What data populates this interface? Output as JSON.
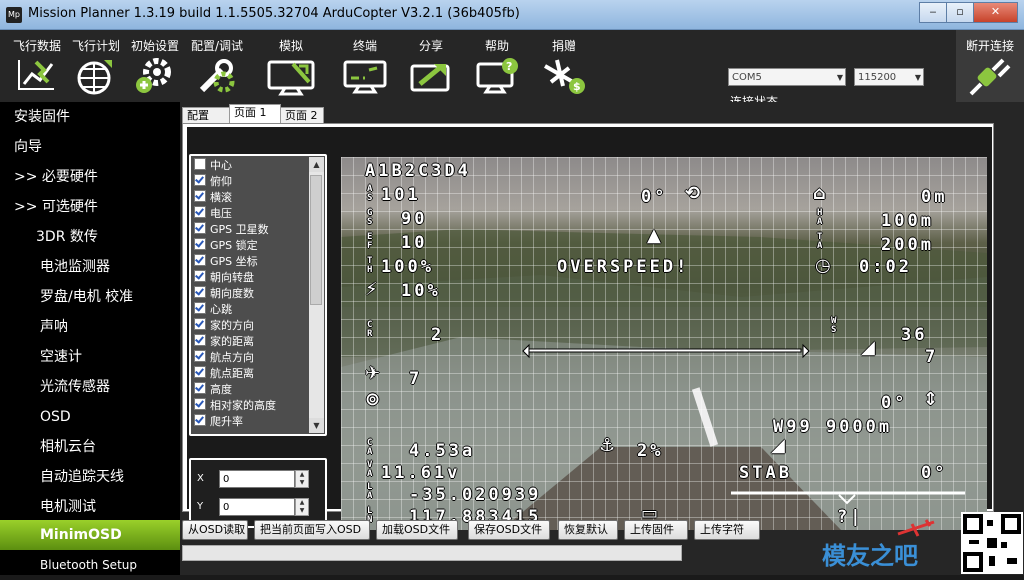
{
  "window": {
    "title": "Mission Planner 1.3.19 build 1.1.5505.32704 ArduCopter V3.2.1 (36b405fb)",
    "icon_label": "Mp",
    "controls": [
      "minimize-icon",
      "restore-icon",
      "close-icon"
    ]
  },
  "menu": {
    "items": [
      {
        "label": "飞行数据",
        "icon": "flight-data-icon"
      },
      {
        "label": "飞行计划",
        "icon": "flight-plan-icon"
      },
      {
        "label": "初始设置",
        "icon": "initial-setup-icon"
      },
      {
        "label": "配置/调试",
        "icon": "config-tuning-icon"
      },
      {
        "label": "模拟",
        "icon": "simulation-icon"
      },
      {
        "label": "终端",
        "icon": "terminal-icon"
      },
      {
        "label": "分享",
        "icon": "share-icon"
      },
      {
        "label": "帮助",
        "icon": "help-icon"
      },
      {
        "label": "捐赠",
        "icon": "donate-icon"
      }
    ],
    "com_port": "COM5",
    "baud_rate": "115200",
    "link_status": "连接状态...",
    "connect_label": "断开连接"
  },
  "sidebar": {
    "items": [
      {
        "label": "安装固件",
        "indent": 0
      },
      {
        "label": "向导",
        "indent": 0
      },
      {
        "label": ">> 必要硬件",
        "indent": 0
      },
      {
        "label": ">> 可选硬件",
        "indent": 0
      },
      {
        "label": "3DR 数传",
        "indent": 1
      },
      {
        "label": "电池监测器",
        "indent": 1
      },
      {
        "label": "罗盘/电机 校准",
        "indent": 1
      },
      {
        "label": "声呐",
        "indent": 1
      },
      {
        "label": "空速计",
        "indent": 1
      },
      {
        "label": "光流传感器",
        "indent": 1
      },
      {
        "label": "OSD",
        "indent": 1
      },
      {
        "label": "相机云台",
        "indent": 1
      },
      {
        "label": "自动追踪天线",
        "indent": 1
      },
      {
        "label": "电机测试",
        "indent": 1
      },
      {
        "label": "MinimOSD",
        "indent": 1,
        "active": true
      },
      {
        "label": "Bluetooth Setup",
        "indent": 1
      }
    ]
  },
  "tabs": [
    {
      "label": "配置",
      "active": false
    },
    {
      "label": "页面 1",
      "active": true
    },
    {
      "label": "页面 2",
      "active": false
    }
  ],
  "osd_items": [
    {
      "label": "中心",
      "checked": false
    },
    {
      "label": "俯仰",
      "checked": true
    },
    {
      "label": "横滚",
      "checked": true
    },
    {
      "label": "电压",
      "checked": true
    },
    {
      "label": "GPS 卫星数",
      "checked": true
    },
    {
      "label": "GPS 锁定",
      "checked": true
    },
    {
      "label": "GPS 坐标",
      "checked": true
    },
    {
      "label": "朝向转盘",
      "checked": true
    },
    {
      "label": "朝向度数",
      "checked": true
    },
    {
      "label": "心跳",
      "checked": true
    },
    {
      "label": "家的方向",
      "checked": true
    },
    {
      "label": "家的距离",
      "checked": true
    },
    {
      "label": "航点方向",
      "checked": true
    },
    {
      "label": "航点距离",
      "checked": true
    },
    {
      "label": "高度",
      "checked": true
    },
    {
      "label": "相对家的高度",
      "checked": true
    },
    {
      "label": "爬升率",
      "checked": true
    }
  ],
  "position": {
    "x_label": "X",
    "x_value": "0",
    "y_label": "Y",
    "y_value": "0"
  },
  "osd_preview": {
    "header": "A1B2C3D4",
    "l1": "101",
    "l2": "90",
    "l3": "10",
    "l4": "100%",
    "l5": "10%",
    "heading": "0°",
    "home_dist": "0m",
    "home_alt": "100m",
    "alt2": "200m",
    "overspeed": "OVERSPEED!",
    "timer": "0:02",
    "climb": "2",
    "wind": "36",
    "wind2": "7",
    "sats": "7",
    "pitch": "0°",
    "waypoint": "W99 9000m",
    "current": "4.53a",
    "throttle": "2%",
    "voltage": "11.61v",
    "mode": "STAB",
    "roll": "0°",
    "lat": "-35.020939",
    "lon": "117.883415",
    "question": "?|"
  },
  "actions": [
    "从OSD读取",
    "把当前页面写入OSD",
    "加载OSD文件",
    "保存OSD文件",
    "恢复默认",
    "上传固件",
    "上传字符"
  ],
  "progress_value": 0,
  "watermark": {
    "text": "模友之吧",
    "url": "www.moz8.com"
  },
  "colors": {
    "active_sidebar": "#7ab51d",
    "background": "#262626"
  }
}
